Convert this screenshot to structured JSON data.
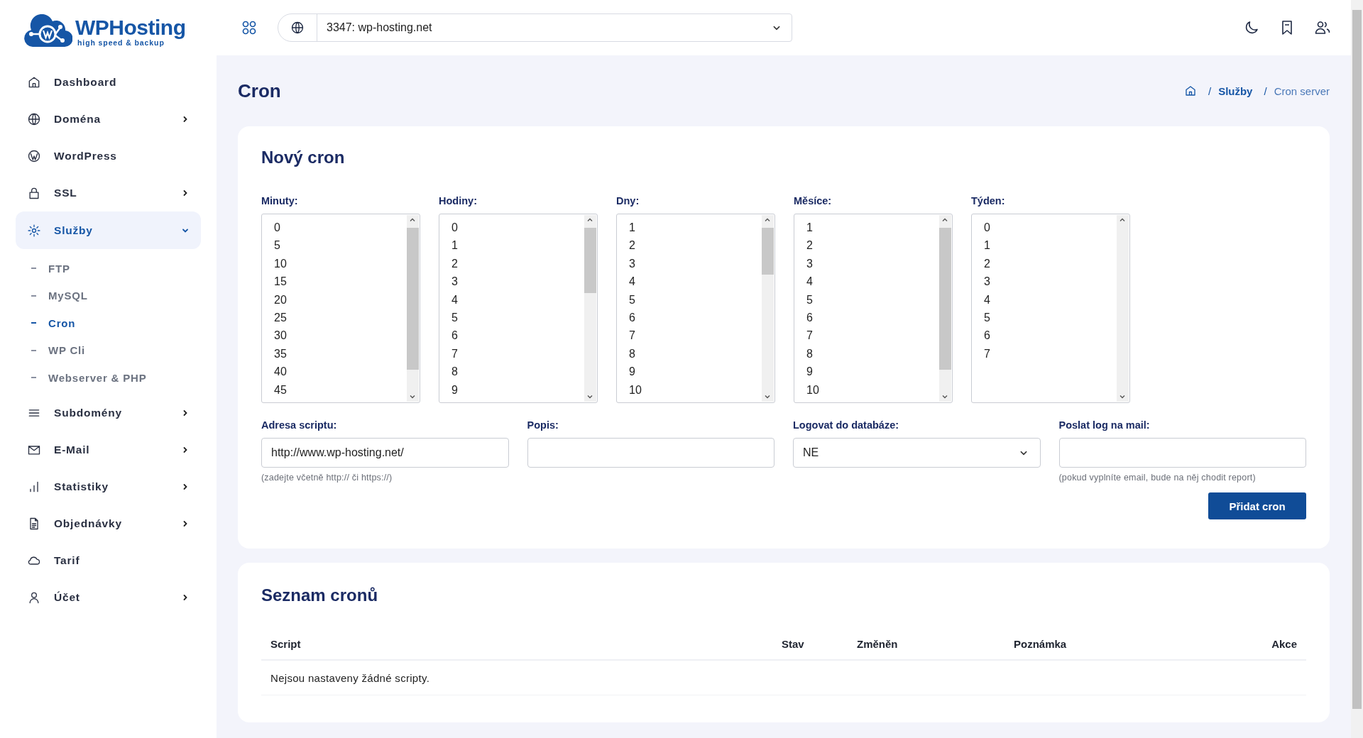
{
  "logo": {
    "name": "WPHosting",
    "tagline": "high speed & backup"
  },
  "sidebar": {
    "items": [
      {
        "label": "Dashboard",
        "expandable": false,
        "selected": false
      },
      {
        "label": "Doména",
        "expandable": true,
        "expanded": false,
        "selected": false
      },
      {
        "label": "WordPress",
        "expandable": false,
        "selected": false
      },
      {
        "label": "SSL",
        "expandable": true,
        "expanded": false,
        "selected": false
      },
      {
        "label": "Služby",
        "expandable": true,
        "expanded": true,
        "selected": true,
        "children": [
          {
            "label": "FTP",
            "selected": false
          },
          {
            "label": "MySQL",
            "selected": false
          },
          {
            "label": "Cron",
            "selected": true
          },
          {
            "label": "WP Cli",
            "selected": false
          },
          {
            "label": "Webserver & PHP",
            "selected": false
          }
        ]
      },
      {
        "label": "Subdomény",
        "expandable": true,
        "expanded": false,
        "selected": false
      },
      {
        "label": "E-Mail",
        "expandable": true,
        "expanded": false,
        "selected": false
      },
      {
        "label": "Statistiky",
        "expandable": true,
        "expanded": false,
        "selected": false
      },
      {
        "label": "Objednávky",
        "expandable": true,
        "expanded": false,
        "selected": false
      },
      {
        "label": "Tarif",
        "expandable": false,
        "selected": false
      },
      {
        "label": "Účet",
        "expandable": true,
        "expanded": false,
        "selected": false
      }
    ]
  },
  "site_selector": {
    "value": "3347: wp-hosting.net"
  },
  "page_title": "Cron",
  "breadcrumb": [
    {
      "separator": "/",
      "label": "Služby",
      "current": false
    },
    {
      "separator": "/",
      "label": "Cron server",
      "current": true
    }
  ],
  "new_cron": {
    "title": "Nový cron",
    "schedule_lists": [
      {
        "label": "Minuty:",
        "options": [
          "0",
          "5",
          "10",
          "15",
          "20",
          "25",
          "30",
          "35",
          "40",
          "45"
        ]
      },
      {
        "label": "Hodiny:",
        "options": [
          "0",
          "1",
          "2",
          "3",
          "4",
          "5",
          "6",
          "7",
          "8",
          "9"
        ]
      },
      {
        "label": "Dny:",
        "options": [
          "1",
          "2",
          "3",
          "4",
          "5",
          "6",
          "7",
          "8",
          "9",
          "10"
        ]
      },
      {
        "label": "Měsíce:",
        "options": [
          "1",
          "2",
          "3",
          "4",
          "5",
          "6",
          "7",
          "8",
          "9",
          "10"
        ]
      },
      {
        "label": "Týden:",
        "options": [
          "0",
          "1",
          "2",
          "3",
          "4",
          "5",
          "6",
          "7"
        ]
      }
    ],
    "fields": [
      {
        "label": "Adresa scriptu:",
        "kind": "text",
        "value": "http://www.wp-hosting.net/",
        "hint": "(zadejte včetně http:// či https://)"
      },
      {
        "label": "Popis:",
        "kind": "text"
      },
      {
        "label": "Logovat do databáze:",
        "kind": "select",
        "value": "NE"
      },
      {
        "label": "Poslat log na mail:",
        "kind": "text",
        "hint": "(pokud vyplníte email, bude na něj chodit report)"
      }
    ],
    "submit": "Přidat cron"
  },
  "cron_list": {
    "title": "Seznam cronů",
    "table": {
      "columns": [
        "Script",
        "Stav",
        "Změněn",
        "Poznámka",
        "Akce"
      ],
      "empty_message": "Nejsou nastaveny žádné scripty."
    }
  }
}
